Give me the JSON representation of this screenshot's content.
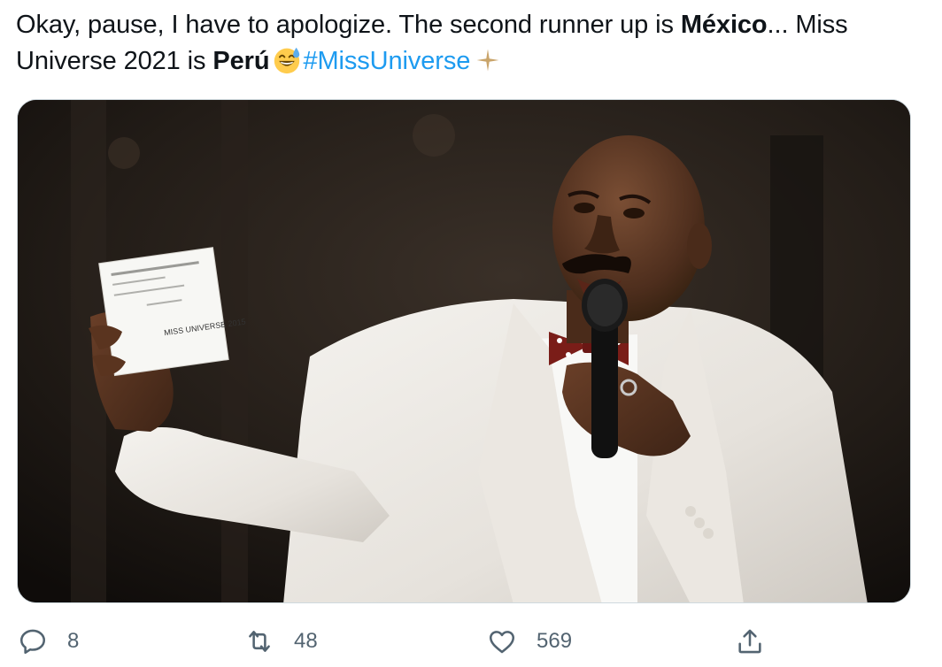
{
  "tweet": {
    "text_part1": "Okay, pause, I have to apologize. The second runner up is ",
    "bold_country_1": "México",
    "text_part2": "... Miss Universe 2021 is ",
    "bold_country_2": "Perú",
    "emoji_1": "grinning-face-with-sweat",
    "hashtag": "#MissUniverse",
    "emoji_2": "sparkle"
  },
  "media": {
    "card_small_text": "MISS UNIVERSE 2015"
  },
  "actions": {
    "reply_count": "8",
    "retweet_count": "48",
    "like_count": "569"
  },
  "colors": {
    "text": "#0f1419",
    "hashtag": "#1d9bf0",
    "muted": "#536471"
  }
}
